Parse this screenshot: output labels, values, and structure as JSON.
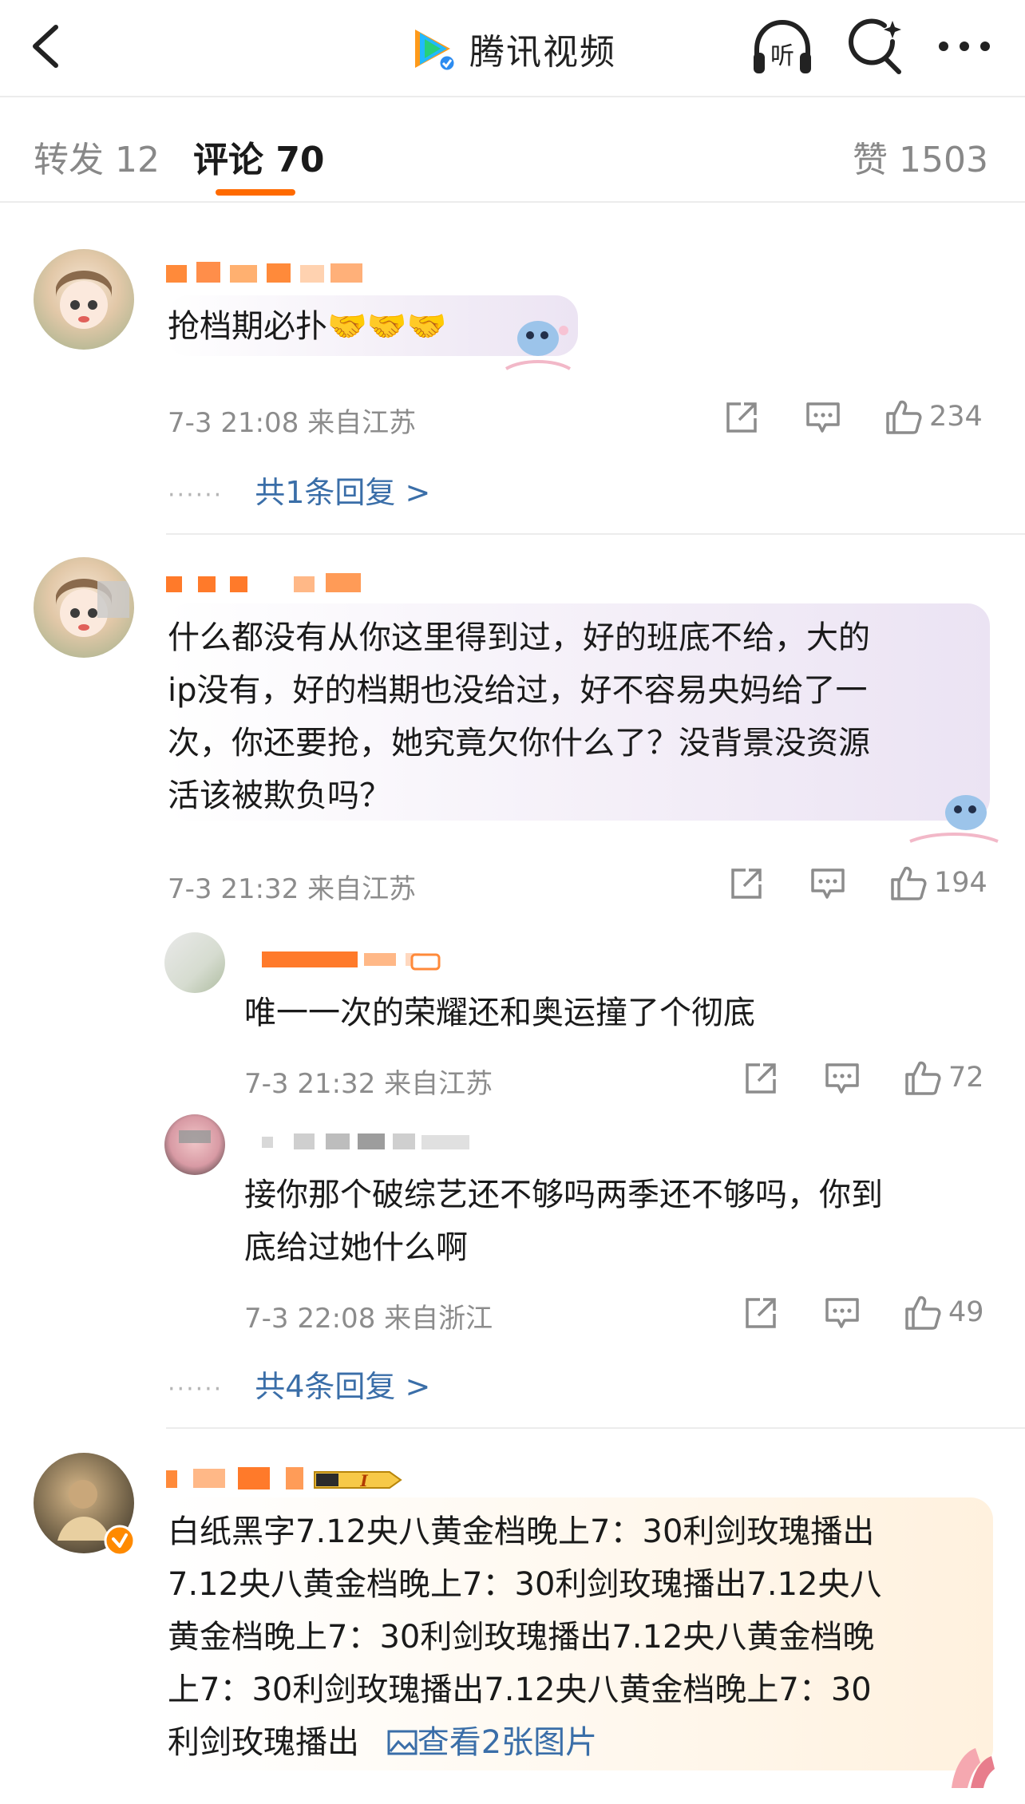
{
  "header": {
    "brand_name": "腾讯视频",
    "icons": [
      "back-arrow-icon",
      "tencent-video-logo",
      "listen-icon",
      "search-icon",
      "more-icon"
    ],
    "listen_label": "听"
  },
  "tabs": {
    "repost": "转发 12",
    "comments": "评论 70",
    "likes": "赞 1503",
    "active_color": "#ff6a00"
  },
  "comments": [
    {
      "text": "抢档期必扑🤝🤝🤝",
      "time": "7-3 21:08 来自江苏",
      "likes": "234",
      "replies_link": "共1条回复 >"
    },
    {
      "text_lines": [
        "什么都没有从你这里得到过，好的班底不给，大的",
        "ip没有，好的档期也没给过，好不容易央妈给了一",
        "次，你还要抢，她究竟欠你什么了？没背景没资源",
        "活该被欺负吗？"
      ],
      "time": "7-3 21:32 来自江苏",
      "likes": "194",
      "replies": [
        {
          "text": "唯一一次的荣耀还和奥运撞了个彻底",
          "time": "7-3 21:32 来自江苏",
          "likes": "72"
        },
        {
          "text_lines": [
            "接你那个破综艺还不够吗两季还不够吗，你到",
            "底给过她什么啊"
          ],
          "time": "7-3 22:08 来自浙江",
          "likes": "49"
        }
      ],
      "replies_link": "共4条回复 >"
    },
    {
      "text_lines": [
        "白纸黑字7.12央八黄金档晚上7：30利剑玫瑰播出",
        "7.12央八黄金档晚上7：30利剑玫瑰播出7.12央八",
        "黄金档晚上7：30利剑玫瑰播出7.12央八黄金档晚",
        "上7：30利剑玫瑰播出7.12央八黄金档晚上7：30",
        "利剑玫瑰播出"
      ],
      "image_link": "查看2张图片",
      "badge": "I"
    }
  ],
  "colors": {
    "link": "#3a6ea8",
    "meta": "#8c8c8c",
    "accent": "#ff6a00"
  }
}
